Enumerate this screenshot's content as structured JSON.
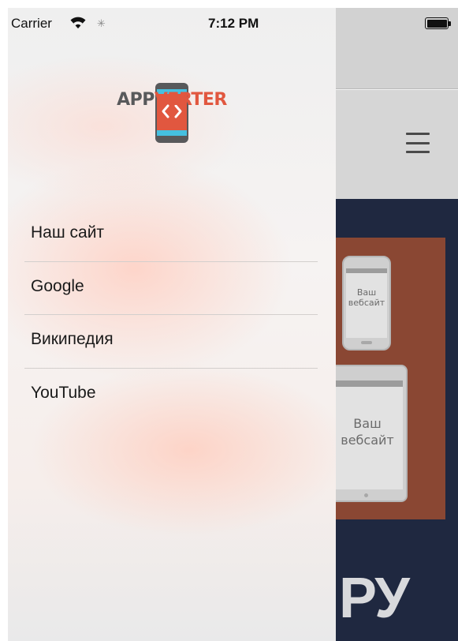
{
  "status_bar": {
    "carrier": "Carrier",
    "time": "7:12 PM"
  },
  "drawer": {
    "logo": {
      "text_part1": "APP",
      "text_part2": "VERTER",
      "color_gray": "#58595b",
      "color_accent": "#e1573f",
      "icon": "phone-code-icon"
    },
    "menu": [
      {
        "label": "Наш сайт"
      },
      {
        "label": "Google"
      },
      {
        "label": "Википедия"
      },
      {
        "label": "YouTube"
      }
    ]
  },
  "background_app": {
    "menu_icon": "hamburger-icon",
    "phone_text": "Ваш вебсайт",
    "tablet_text": "Ваш вебсайт",
    "big_text": "РУ",
    "dark_color": "#1f2840",
    "panel_color": "#8a4733"
  }
}
